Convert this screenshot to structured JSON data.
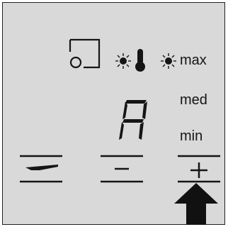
{
  "display": {
    "digit": "A"
  },
  "levels": {
    "max": "max",
    "med": "med",
    "min": "min"
  },
  "icons": {
    "top_row": [
      "keep-warm-icon",
      "indicator-light-icon",
      "thermometer-icon",
      "indicator-light-icon"
    ],
    "buttons": [
      "pan-icon",
      "minus-icon",
      "plus-icon"
    ],
    "pointer": "arrow-up-icon"
  },
  "buttons": {
    "pan": "pan-button",
    "minus": "minus-button",
    "plus": "plus-button"
  },
  "colors": {
    "panel_background": "#d9d9d9",
    "ink": "#151515"
  }
}
